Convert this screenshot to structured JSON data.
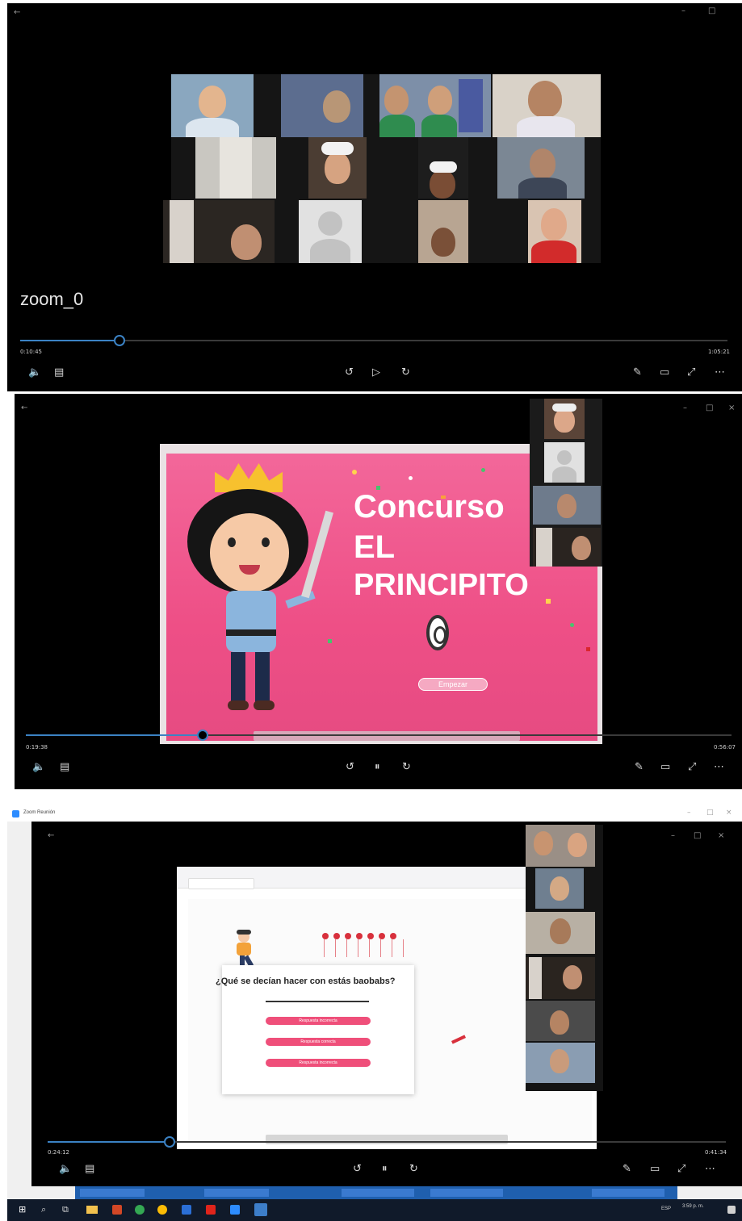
{
  "colors": {
    "accent": "#3b82c4",
    "slide_pink": "#f04f7e",
    "panel_black": "#000000"
  },
  "player1": {
    "title": "zoom_0",
    "time_current": "0:10:45",
    "time_total": "1:05:21",
    "progress": 0.14
  },
  "player2": {
    "slide_title_line1": "Concurso",
    "slide_title_line2": "EL",
    "slide_title_line3": "PRINCIPITO",
    "start_button": "Empezar",
    "time_current": "0:19:38",
    "time_total": "0:56:07",
    "progress": 0.25
  },
  "player3": {
    "app_title": "Zoom Reunión",
    "question": "¿Qué se decían hacer con estás baobabs?",
    "answers": [
      "Respuesta incorrecta",
      "Respuesta correcta",
      "Respuesta incorrecta"
    ],
    "time_current": "0:24:12",
    "time_total": "0:41:34",
    "progress": 0.18,
    "tray_time": "3:59 p. m.",
    "tray_lang": "ESP"
  },
  "icons": {
    "back": "arrow-left-icon",
    "volume": "volume-icon",
    "captions": "captions-icon",
    "skip_back": "skip-back-10-icon",
    "play": "play-icon",
    "pause": "pause-icon",
    "skip_forward": "skip-forward-30-icon",
    "edit": "pen-icon",
    "miniplayer": "miniplayer-icon",
    "fullscreen": "fullscreen-icon",
    "more": "more-icon"
  }
}
